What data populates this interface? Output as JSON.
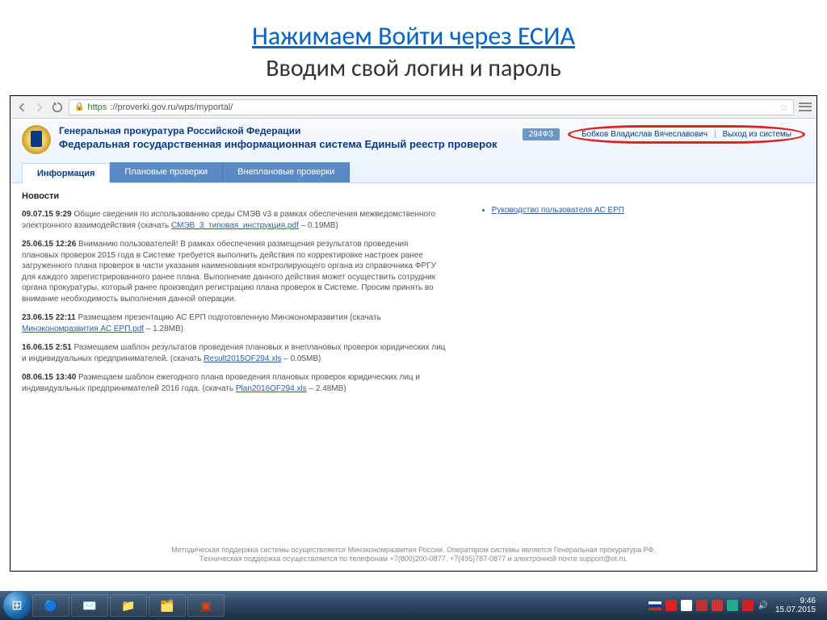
{
  "slide": {
    "title_line1": "Нажимаем Войти через ЕСИА",
    "title_line2": "Вводим свой логин и пароль"
  },
  "browser": {
    "url_https": "https",
    "url_rest": "://proverki.gov.ru/wps/myportal/"
  },
  "header": {
    "org_line1": "Генеральная прокуратура Российской Федерации",
    "org_line2": "Федеральная государственная информационная система Единый реестр проверок",
    "badge": "294ФЗ",
    "user": "Бобков Владислав Вячеславович",
    "logout": "Выход из системы"
  },
  "tabs": {
    "info": "Информация",
    "planned": "Плановые проверки",
    "unplanned": "Внеплановые проверки"
  },
  "news": {
    "heading": "Новости",
    "items": [
      {
        "date": "09.07.15 9:29",
        "text_before": " Общие сведения по использованию среды СМЭВ v3 в рамках обеспечения межведомственного электронного взаимодействия (скачать ",
        "link": "СМЭВ_3_типовая_инструкция.pdf",
        "text_after": " – 0.19MB)"
      },
      {
        "date": "25.06.15 12:26",
        "text_before": " Вниманию пользователей! В рамках обеспечения размещения результатов проведения плановых проверок 2015 года в Системе требуется выполнить действия по корректировке настроек ранее загруженного плана проверок в части указания наименования контролирующего органа из справочника ФРГУ для каждого зарегистрированного ранее плана. Выполнение данного действия может осуществить сотрудник органа прокуратуры, который ранее производил регистрацию плана проверок в Системе. Просим принять во внимание необходимость выполнения данной операции.",
        "link": "",
        "text_after": ""
      },
      {
        "date": "23.06.15 22:11",
        "text_before": " Размещаем презентацию АС ЕРП подготовленную Минэкономразвития (скачать ",
        "link": "Минэкономразвития АС ЕРП.pdf",
        "text_after": " – 1.28MB)"
      },
      {
        "date": "16.06.15 2:51",
        "text_before": " Размещаем шаблон результатов проведения плановых и внеплановых проверок юридических лиц и индивидуальных предпринимателей. (скачать ",
        "link": "Result2015OF294.xls",
        "text_after": " – 0.05MB)"
      },
      {
        "date": "08.06.15 13:40",
        "text_before": " Размещаем шаблон ежегодного плана проведения плановых проверок юридических лиц и индивидуальных предпринимателей 2016 года. (скачать ",
        "link": "Plan2016OF294.xls",
        "text_after": " – 2.48MB)"
      }
    ]
  },
  "sidebar": {
    "guide_link": "Руководство пользователя АС ЕРП"
  },
  "page_footer": {
    "line1": "Методическая поддержка системы осуществляется Минэкономразвития России. Оператором системы является Генеральная прокуратура РФ.",
    "line2": "Техническая поддержка осуществляется по телефонам +7(800)200-0877, +7(495)787-0877 и электронной почте support@ot.ru."
  },
  "taskbar": {
    "time": "9:46",
    "date": "15.07.2015"
  }
}
